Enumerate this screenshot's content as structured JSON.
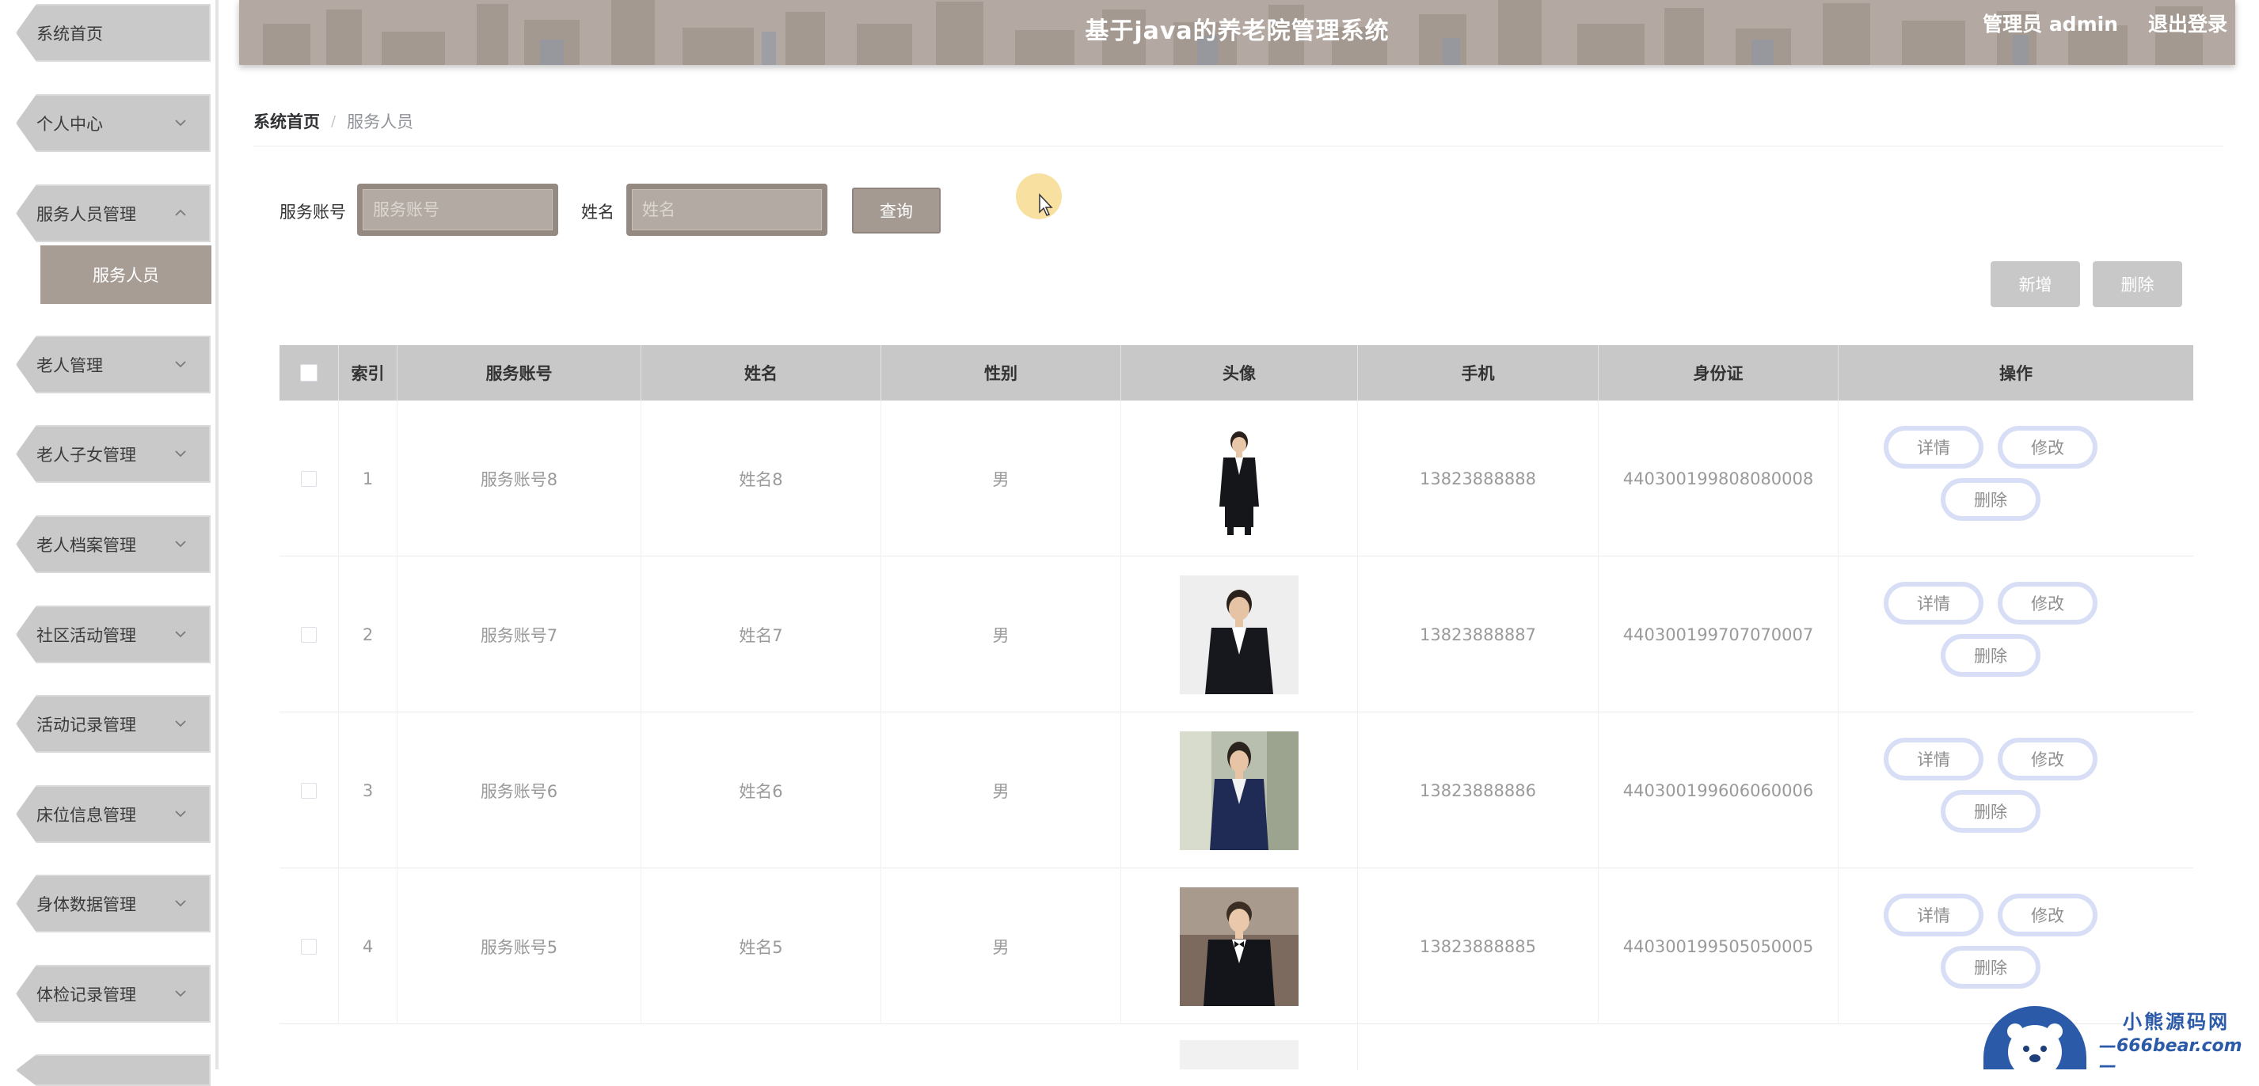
{
  "header": {
    "title": "基于java的养老院管理系统",
    "user": "管理员 admin",
    "logout": "退出登录"
  },
  "sidebar": {
    "items": [
      {
        "label": "系统首页",
        "has_arrow": false
      },
      {
        "label": "个人中心",
        "has_arrow": true,
        "arrow": "chevron-down"
      },
      {
        "label": "服务人员管理",
        "has_arrow": true,
        "arrow": "chevron-up",
        "expanded": true
      },
      {
        "label": "老人管理",
        "has_arrow": true,
        "arrow": "chevron-down"
      },
      {
        "label": "老人子女管理",
        "has_arrow": true,
        "arrow": "chevron-down"
      },
      {
        "label": "老人档案管理",
        "has_arrow": true,
        "arrow": "chevron-down"
      },
      {
        "label": "社区活动管理",
        "has_arrow": true,
        "arrow": "chevron-down"
      },
      {
        "label": "活动记录管理",
        "has_arrow": true,
        "arrow": "chevron-down"
      },
      {
        "label": "床位信息管理",
        "has_arrow": true,
        "arrow": "chevron-down"
      },
      {
        "label": "身体数据管理",
        "has_arrow": true,
        "arrow": "chevron-down"
      },
      {
        "label": "体检记录管理",
        "has_arrow": true,
        "arrow": "chevron-down"
      }
    ],
    "submenu": {
      "label": "服务人员"
    }
  },
  "breadcrumb": {
    "home": "系统首页",
    "separator": "/",
    "current": "服务人员"
  },
  "search": {
    "account_label": "服务账号",
    "account_placeholder": "服务账号",
    "name_label": "姓名",
    "name_placeholder": "姓名",
    "query_button": "查询"
  },
  "actions": {
    "add": "新增",
    "delete": "删除"
  },
  "table": {
    "columns": [
      "索引",
      "服务账号",
      "姓名",
      "性别",
      "头像",
      "手机",
      "身份证",
      "操作"
    ],
    "rows": [
      {
        "index": "1",
        "account": "服务账号8",
        "name": "姓名8",
        "gender": "男",
        "phone": "13823888888",
        "id_card": "440300199808080008"
      },
      {
        "index": "2",
        "account": "服务账号7",
        "name": "姓名7",
        "gender": "男",
        "phone": "13823888887",
        "id_card": "440300199707070007"
      },
      {
        "index": "3",
        "account": "服务账号6",
        "name": "姓名6",
        "gender": "男",
        "phone": "13823888886",
        "id_card": "440300199606060006"
      },
      {
        "index": "4",
        "account": "服务账号5",
        "name": "姓名5",
        "gender": "男",
        "phone": "13823888885",
        "id_card": "440300199505050005"
      }
    ],
    "row_buttons": {
      "detail": "详情",
      "edit": "修改",
      "delete": "删除"
    }
  },
  "watermark": {
    "line1": "小熊源码网",
    "line2": "—666bear.com—"
  },
  "colors": {
    "header_bg": "#b3a9a2",
    "submenu_active": "#a89d95",
    "table_header": "#c8c8c8",
    "op_button_border": "#d7def5",
    "watermark": "#2b5aa8"
  }
}
